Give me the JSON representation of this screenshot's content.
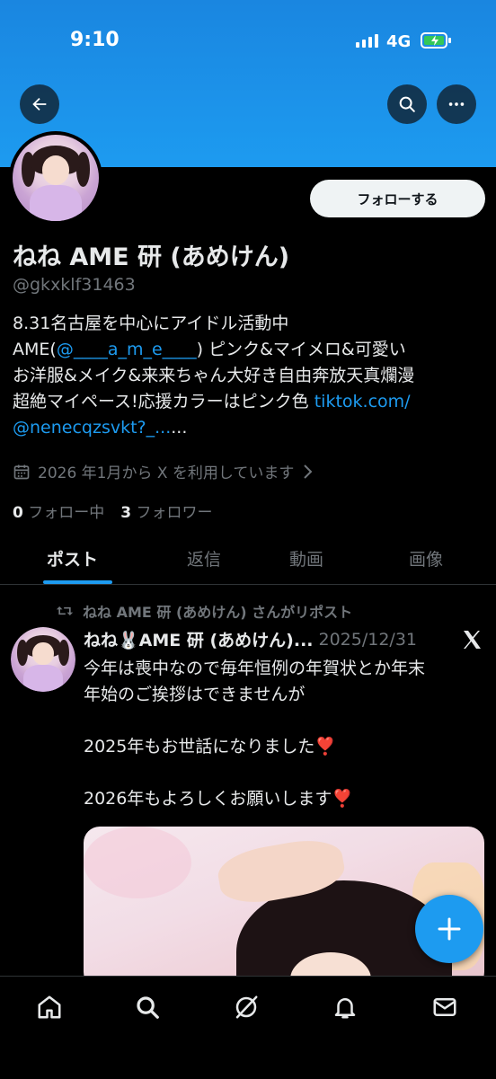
{
  "status_bar": {
    "time": "9:10",
    "network": "4G"
  },
  "profile": {
    "name": "ねね AME 研 (あめけん)",
    "handle": "@gkxklf31463",
    "follow_label": "フォローする",
    "bio": {
      "line1": "8.31名古屋を中心にアイドル活動中",
      "line2_prefix": "AME(",
      "line2_link": "@____a_m_e____",
      "line2_suffix": ") ピンク&マイメロ&可愛い",
      "line3": "お洋服&メイク&来来ちゃん大好き自由奔放天真爛漫",
      "line4_prefix": "超絶マイペース!応援カラーはピンク色 ",
      "line4_link": "tiktok.com/",
      "line5_link": "@nenecqzsvkt?_...",
      "line5_suffix": "..."
    },
    "joined": "2026 年1月から X を利用しています",
    "following_count": "0",
    "following_label": "フォロー中",
    "followers_count": "3",
    "followers_label": "フォロワー"
  },
  "tabs": [
    {
      "label": "ポスト",
      "active": true
    },
    {
      "label": "返信",
      "active": false
    },
    {
      "label": "動画",
      "active": false
    },
    {
      "label": "画像",
      "active": false
    }
  ],
  "post": {
    "repost_label": "ねね AME 研 (あめけん) さんがリポスト",
    "author": "ねね🐰AME 研 (あめけん)...",
    "date": "2025/12/31",
    "text": "今年は喪中なので毎年恒例の年賀状とか年末\n年始のご挨拶はできませんが\n\n2025年もお世話になりました❣️\n\n2026年もよろしくお願いします❣️"
  },
  "icons": {
    "back": "back-arrow-icon",
    "search": "search-icon",
    "more": "more-icon",
    "calendar": "calendar-icon",
    "repost": "repost-icon",
    "x": "x-logo-icon",
    "compose": "plus-icon",
    "nav": [
      "home-icon",
      "search-icon",
      "grok-icon",
      "notifications-icon",
      "messages-icon"
    ]
  },
  "colors": {
    "accent": "#1d9bf0",
    "banner": "#1d9bf0",
    "background": "#000000"
  }
}
